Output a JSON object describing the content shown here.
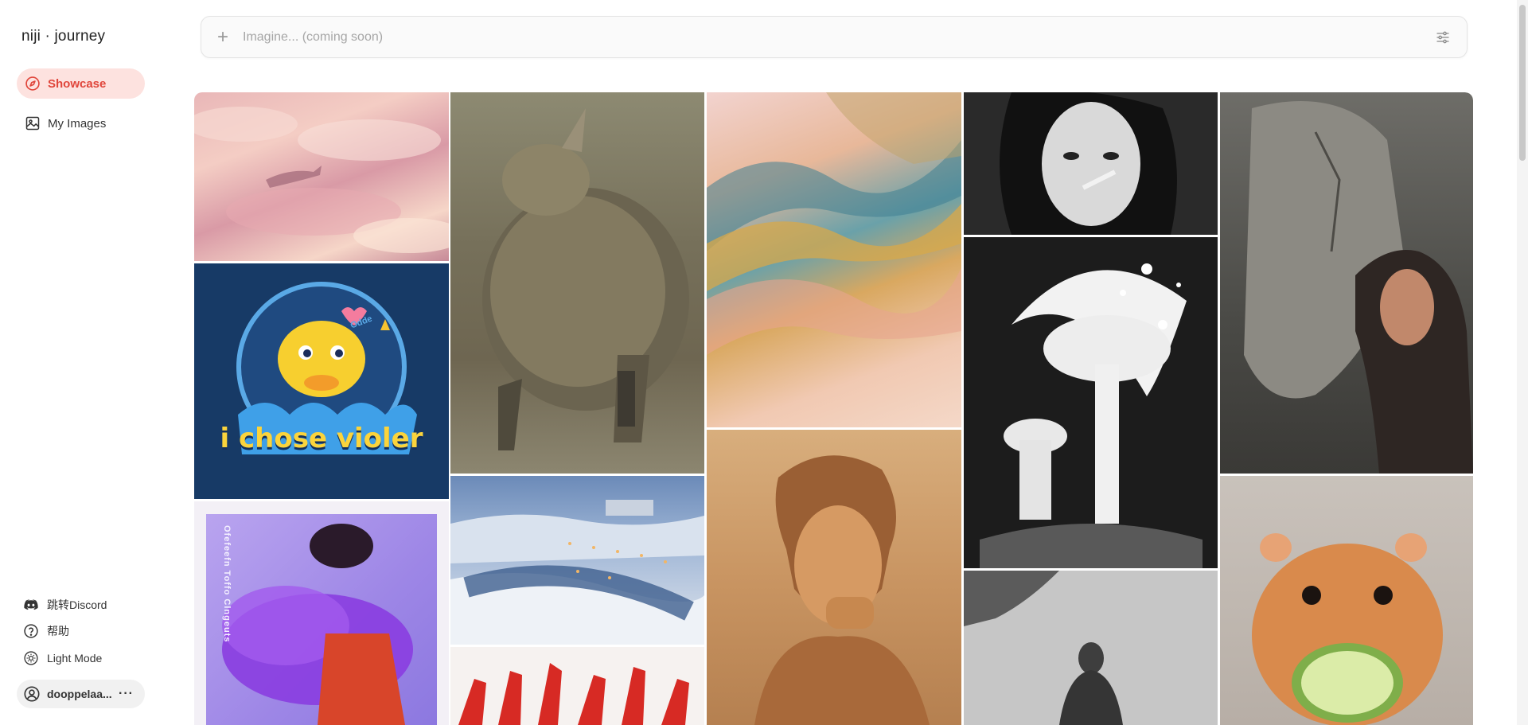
{
  "app": {
    "title": "niji · journey"
  },
  "nav": [
    {
      "label": "Showcase",
      "icon": "compass-icon",
      "active": true
    },
    {
      "label": "My Images",
      "icon": "image-icon",
      "active": false
    }
  ],
  "bottom": {
    "discord": "跳转Discord",
    "help": "帮助",
    "theme": "Light Mode",
    "user": "dooppelaa..."
  },
  "prompt": {
    "placeholder": "Imagine... (coming soon)"
  },
  "gallery": {
    "tiles": [
      {
        "desc": "pink clouds with flying squid",
        "icon": "image-tile"
      },
      {
        "desc": "giant armadillo creature with knights",
        "icon": "image-tile"
      },
      {
        "desc": "watercolor gold and teal abstract",
        "icon": "image-tile"
      },
      {
        "desc": "black and white girl smoking",
        "icon": "image-tile"
      },
      {
        "desc": "stone face kissed by woman",
        "icon": "image-tile"
      },
      {
        "desc": "duck mascot sticker",
        "text": "i chose violer",
        "badge": "Odde",
        "icon": "image-tile"
      },
      {
        "desc": "snowy city river at dusk",
        "icon": "image-tile"
      },
      {
        "desc": "vintage portrait man smoking",
        "icon": "image-tile"
      },
      {
        "desc": "mushroom house illustration",
        "icon": "image-tile"
      },
      {
        "desc": "hamster eating cucumber",
        "icon": "image-tile"
      },
      {
        "desc": "purple smoke portrait poster",
        "text": "Ofefeefn Toffo Clngeuts",
        "icon": "image-tile"
      },
      {
        "desc": "red dancers",
        "icon": "image-tile"
      },
      {
        "desc": "old black and white monk photo",
        "icon": "image-tile"
      }
    ]
  },
  "colors": {
    "accent": "#e0453a",
    "accent_bg": "#fde2df"
  }
}
